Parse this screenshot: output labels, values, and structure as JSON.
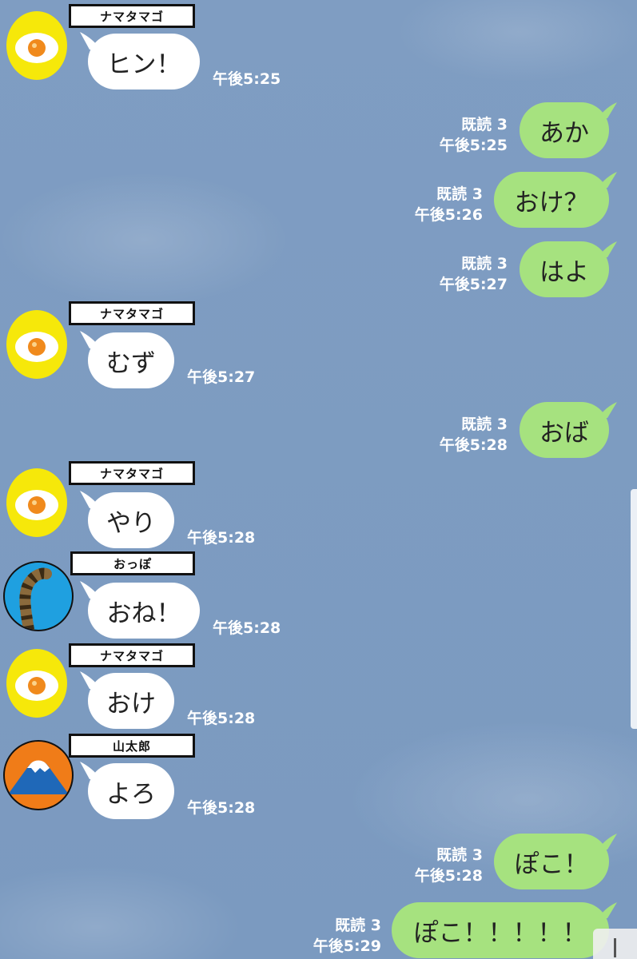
{
  "chat": {
    "read_label": "既読 3",
    "messages": [
      {
        "dir": "in",
        "sender": "ナマタマゴ",
        "avatar": "fried-egg",
        "text": "ヒン！",
        "time": "午後5:25"
      },
      {
        "dir": "out",
        "text": "あか",
        "read": "既読 3",
        "time": "午後5:25"
      },
      {
        "dir": "out",
        "text": "おけ？",
        "read": "既読 3",
        "time": "午後5:26"
      },
      {
        "dir": "out",
        "text": "はよ",
        "read": "既読 3",
        "time": "午後5:27"
      },
      {
        "dir": "in",
        "sender": "ナマタマゴ",
        "avatar": "fried-egg",
        "text": "むず",
        "time": "午後5:27"
      },
      {
        "dir": "out",
        "text": "おば",
        "read": "既読 3",
        "time": "午後5:28"
      },
      {
        "dir": "in",
        "sender": "ナマタマゴ",
        "avatar": "fried-egg",
        "text": "やり",
        "time": "午後5:28"
      },
      {
        "dir": "in",
        "sender": "おっぽ",
        "avatar": "tail",
        "text": "おね！",
        "time": "午後5:28"
      },
      {
        "dir": "in",
        "sender": "ナマタマゴ",
        "avatar": "fried-egg",
        "text": "おけ",
        "time": "午後5:28"
      },
      {
        "dir": "in",
        "sender": "山太郎",
        "avatar": "mount-fuji",
        "text": "よろ",
        "time": "午後5:28"
      },
      {
        "dir": "out",
        "text": "ぽこ！",
        "read": "既読 3",
        "time": "午後5:28"
      },
      {
        "dir": "out",
        "text": "ぽこ！！！！！",
        "read": "既読 3",
        "time": "午後5:29"
      }
    ]
  },
  "colors": {
    "background": "#7e9cc0",
    "incoming_bubble": "#ffffff",
    "outgoing_bubble": "#a6e27f",
    "egg_avatar_bg": "#f6e80a"
  }
}
